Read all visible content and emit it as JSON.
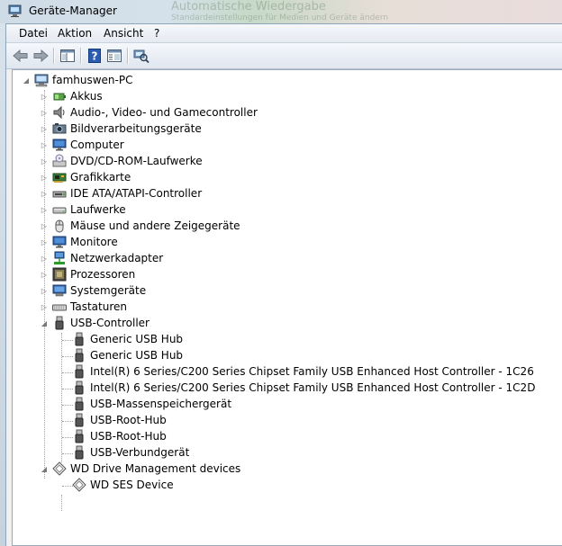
{
  "window": {
    "title": "Geräte-Manager",
    "background_hint_1": "Automatische Wiedergabe",
    "background_hint_2": "Standardeinstellungen für Medien und Geräte ändern"
  },
  "menu": {
    "items": [
      {
        "label": "Datei"
      },
      {
        "label": "Aktion"
      },
      {
        "label": "Ansicht"
      },
      {
        "label": "?"
      }
    ]
  },
  "toolbar": {
    "buttons": [
      {
        "icon": "back-arrow-icon"
      },
      {
        "icon": "forward-arrow-icon"
      },
      {
        "icon": "show-hide-console-tree-icon"
      },
      {
        "icon": "help-icon"
      },
      {
        "icon": "properties-icon"
      },
      {
        "icon": "scan-hardware-icon"
      }
    ]
  },
  "tree": {
    "root": {
      "label": "famhuswen-PC",
      "icon": "computer-icon"
    },
    "categories": [
      {
        "label": "Akkus",
        "icon": "battery-icon"
      },
      {
        "label": "Audio-, Video- und Gamecontroller",
        "icon": "speaker-icon"
      },
      {
        "label": "Bildverarbeitungsgeräte",
        "icon": "camera-icon"
      },
      {
        "label": "Computer",
        "icon": "monitor-icon"
      },
      {
        "label": "DVD/CD-ROM-Laufwerke",
        "icon": "dvd-drive-icon"
      },
      {
        "label": "Grafikkarte",
        "icon": "display-adapter-icon"
      },
      {
        "label": "IDE ATA/ATAPI-Controller",
        "icon": "ide-controller-icon"
      },
      {
        "label": "Laufwerke",
        "icon": "disk-drive-icon"
      },
      {
        "label": "Mäuse und andere Zeigegeräte",
        "icon": "mouse-icon"
      },
      {
        "label": "Monitore",
        "icon": "monitor-icon"
      },
      {
        "label": "Netzwerkadapter",
        "icon": "network-adapter-icon"
      },
      {
        "label": "Prozessoren",
        "icon": "processor-icon"
      },
      {
        "label": "Systemgeräte",
        "icon": "system-device-icon"
      },
      {
        "label": "Tastaturen",
        "icon": "keyboard-icon"
      }
    ],
    "usb": {
      "label": "USB-Controller",
      "icon": "usb-plug-icon",
      "children": [
        {
          "label": "Generic USB Hub"
        },
        {
          "label": "Generic USB Hub"
        },
        {
          "label": "Intel(R) 6 Series/C200 Series Chipset Family USB Enhanced Host Controller - 1C26"
        },
        {
          "label": "Intel(R) 6 Series/C200 Series Chipset Family USB Enhanced Host Controller - 1C2D"
        },
        {
          "label": "USB-Massenspeichergerät"
        },
        {
          "label": "USB-Root-Hub"
        },
        {
          "label": "USB-Root-Hub"
        },
        {
          "label": "USB-Verbundgerät"
        }
      ]
    },
    "wd": {
      "label": "WD Drive Management devices",
      "icon": "wd-diamond-icon",
      "children": [
        {
          "label": "WD SES Device"
        }
      ]
    }
  },
  "colors": {
    "title_bar": "#d5e1ea",
    "tree_background": "#ffffff",
    "help_icon_blue": "#2a5db0"
  }
}
